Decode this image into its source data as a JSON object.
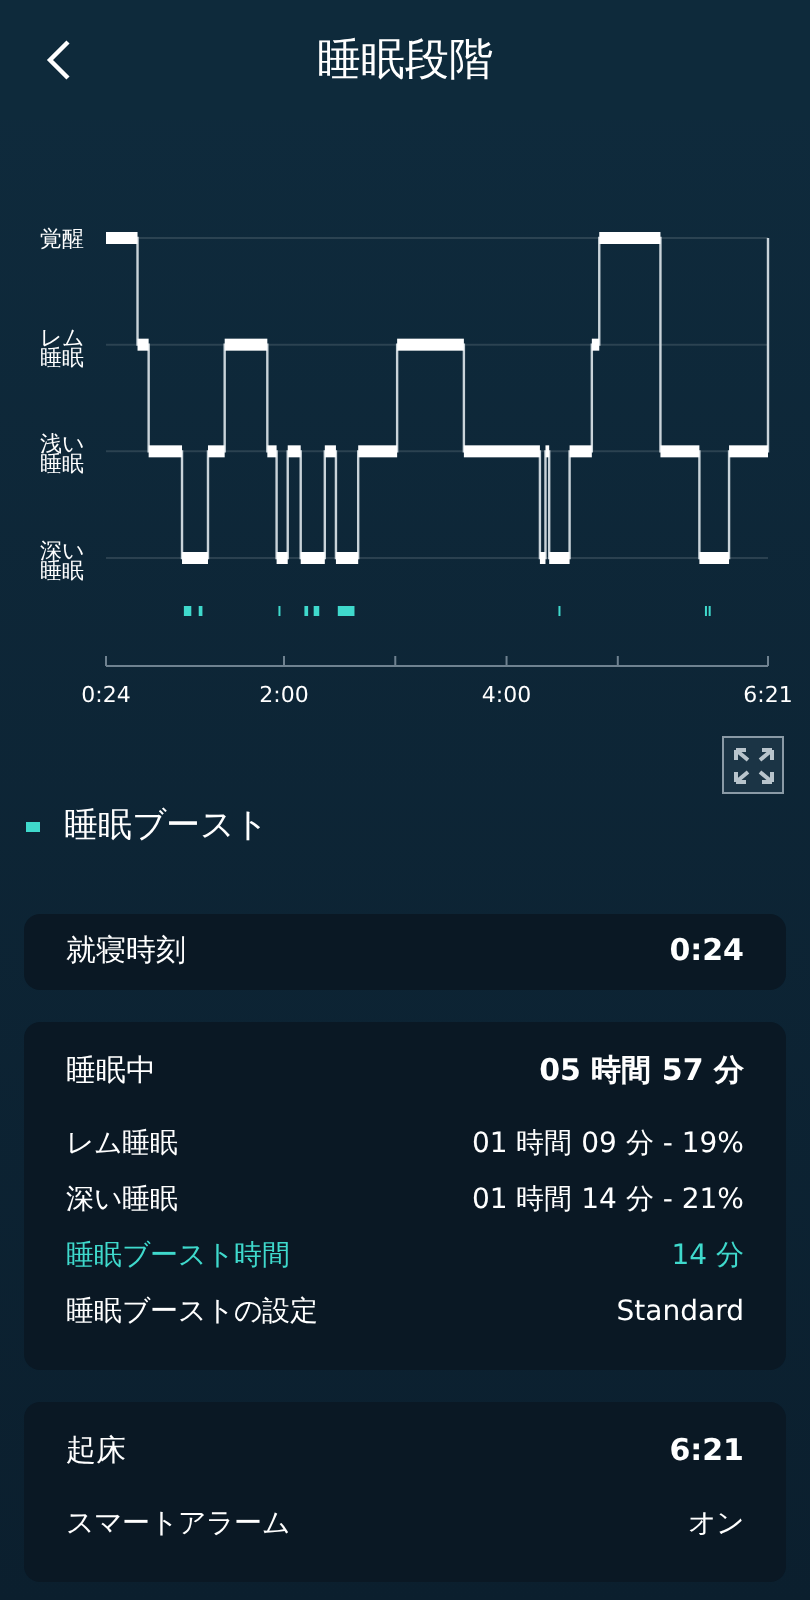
{
  "header": {
    "title": "睡眠段階"
  },
  "hypnogram": {
    "stage_labels": [
      "覚醒",
      "レム睡眠",
      "浅い睡眠",
      "深い睡眠"
    ],
    "time_labels": [
      "0:24",
      "2:00",
      "4:00",
      "6:21"
    ]
  },
  "legend": {
    "label": "睡眠ブースト",
    "color": "#3fd9cc"
  },
  "cards": [
    {
      "rows": [
        {
          "kind": "primary",
          "label": "就寝時刻",
          "value": "0:24"
        }
      ]
    },
    {
      "rows": [
        {
          "kind": "primary",
          "label": "睡眠中",
          "value": "05 時間 57 分"
        },
        {
          "kind": "detail",
          "label": "レム睡眠",
          "value": "01 時間 09 分 - 19%"
        },
        {
          "kind": "detail",
          "label": "深い睡眠",
          "value": "01 時間 14 分 - 21%"
        },
        {
          "kind": "accent",
          "label": "睡眠ブースト時間",
          "value": "14 分"
        },
        {
          "kind": "detail",
          "label": "睡眠ブーストの設定",
          "value": "Standard"
        }
      ]
    },
    {
      "rows": [
        {
          "kind": "primary",
          "label": "起床",
          "value": "6:21"
        },
        {
          "kind": "detail",
          "label": "スマートアラーム",
          "value": "オン"
        }
      ]
    }
  ]
}
